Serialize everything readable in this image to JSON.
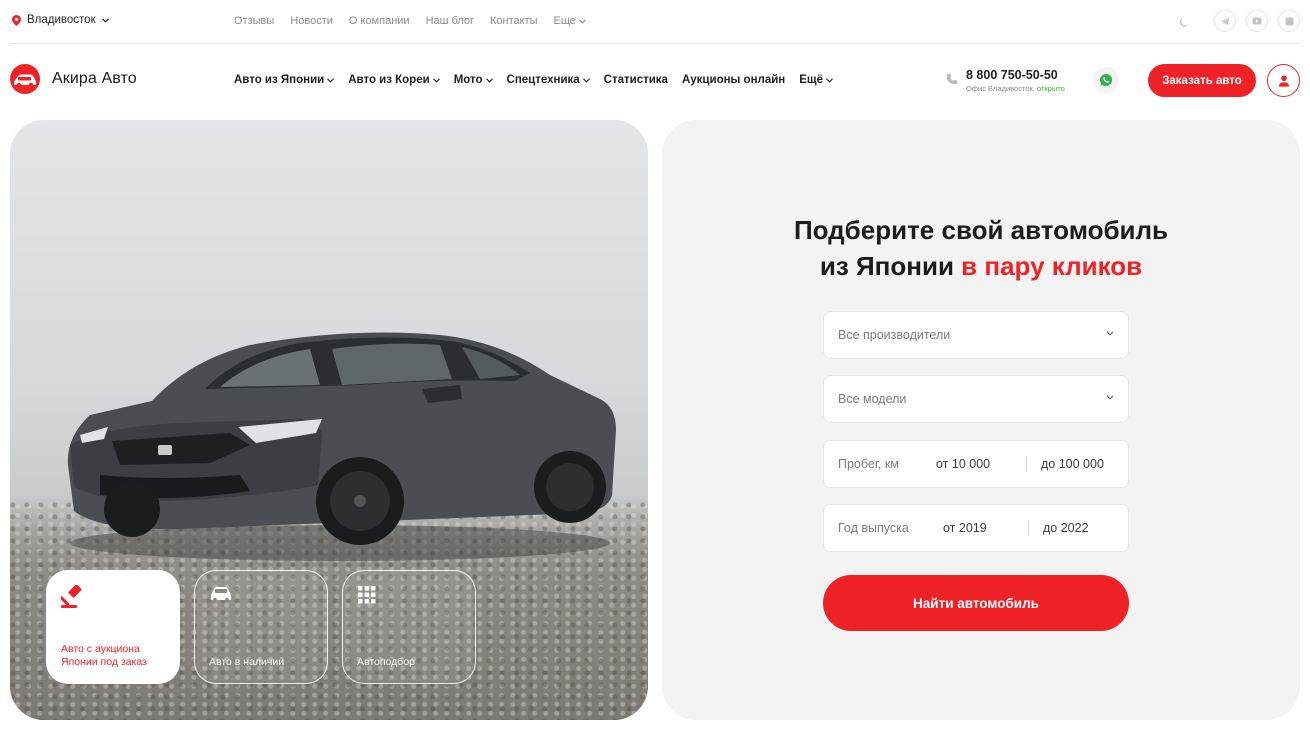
{
  "topbar": {
    "city": "Владивосток",
    "links": [
      "Отзывы",
      "Новости",
      "О компании",
      "Наш блог",
      "Контакты"
    ],
    "more_label": "Еще"
  },
  "header": {
    "logo_text": "Акира Авто",
    "nav": [
      "Авто из Японии",
      "Авто из Кореи",
      "Мото",
      "Спецтехника",
      "Статистика",
      "Аукционы онлайн",
      "Ещё"
    ],
    "phone": "8 800 750-50-50",
    "office_text": "Офис Владивосток,",
    "office_status": "открыто",
    "order_button": "Заказать авто"
  },
  "hero": {
    "cards": [
      {
        "label": "Авто с аукциона Японии под заказ",
        "icon": "gavel-icon"
      },
      {
        "label": "Авто в наличии",
        "icon": "car-icon"
      },
      {
        "label": "Автоподбор",
        "icon": "grid-icon"
      }
    ]
  },
  "search": {
    "title_line1": "Подберите свой автомобиль",
    "title_line2_plain": "из Японии",
    "title_line2_accent": "в пару кликов",
    "manufacturer_placeholder": "Все производители",
    "model_placeholder": "Все модели",
    "mileage_label": "Пробег, км",
    "mileage_from": "от 10 000",
    "mileage_to": "до 100 000",
    "year_label": "Год выпуска",
    "year_from": "от 2019",
    "year_to": "до 2022",
    "submit_label": "Найти автомобиль"
  },
  "colors": {
    "accent": "#ee2227",
    "panel_bg": "#f3f3f3",
    "status_open": "#3ab53a"
  }
}
